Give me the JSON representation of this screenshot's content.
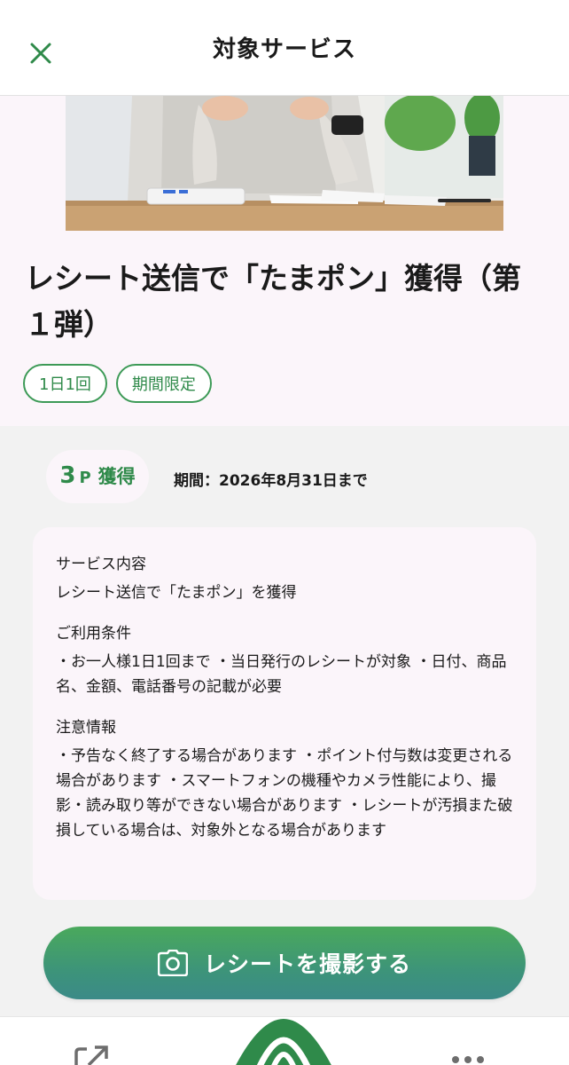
{
  "header": {
    "title": "対象サービス",
    "close_icon": "close-icon"
  },
  "hero": {
    "image": "person-holding-receipt-photo"
  },
  "main": {
    "title": "レシート送信で「たまポン」獲得（第１弾）",
    "tags": [
      "1日1回",
      "期間限定"
    ]
  },
  "points": {
    "number": "3",
    "unit": "P",
    "label": "獲得"
  },
  "period": "期間：2026年8月31日まで",
  "info": {
    "service_heading": "サービス内容",
    "service_text": "レシート送信で「たまポン」を獲得",
    "conditions_heading": "ご利用条件",
    "conditions_text": "・お一人様1日1回まで ・当日発行のレシートが対象 ・日付、商品名、金額、電話番号の記載が必要",
    "notes_heading": "注意情報",
    "notes_text": "・予告なく終了する場合があります ・ポイント付与数は変更される場合があります ・スマートフォンの機種やカメラ性能により、撮影・読み取り等ができない場合があります ・レシートが汚損また破損している場合は、対象外となる場合があります"
  },
  "action": {
    "capture_label": "レシートを撮影する",
    "capture_icon": "camera-icon"
  },
  "bottom_nav": {
    "share_icon": "share-icon",
    "home_icon": "home-logo-icon",
    "more_icon": "more-icon"
  },
  "colors": {
    "accent": "#3d9a57",
    "button_gradient_top": "#4aa95c",
    "button_gradient_bottom": "#3b8a88",
    "card_bg": "#fbf5fa",
    "page_bg": "#f2f2f2"
  }
}
